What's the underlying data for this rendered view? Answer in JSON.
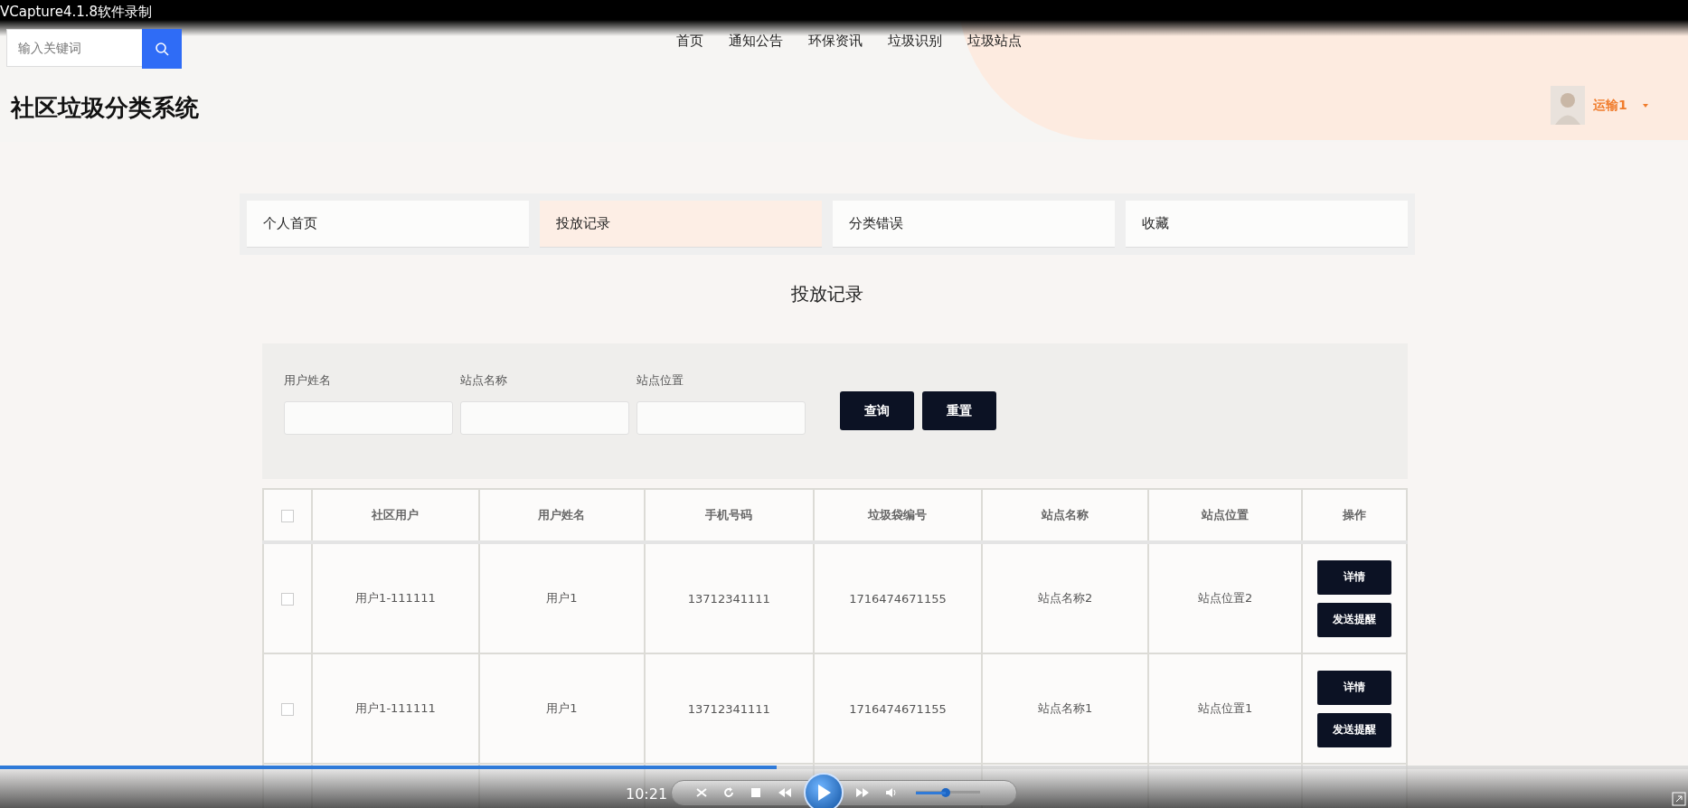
{
  "recorder": {
    "title": "VCapture4.1.8软件录制"
  },
  "header": {
    "search": {
      "placeholder": "输入关键词"
    },
    "nav": [
      "首页",
      "通知公告",
      "环保资讯",
      "垃圾识别",
      "垃圾站点"
    ],
    "site_title": "社区垃圾分类系统",
    "user": {
      "name": "运输1"
    }
  },
  "tabs": [
    {
      "label": "个人首页",
      "selected": false
    },
    {
      "label": "投放记录",
      "selected": true
    },
    {
      "label": "分类错误",
      "selected": false
    },
    {
      "label": "收藏",
      "selected": false
    }
  ],
  "heading": "投放记录",
  "filters": {
    "fields": [
      {
        "label": "用户姓名"
      },
      {
        "label": "站点名称"
      },
      {
        "label": "站点位置"
      }
    ],
    "buttons": [
      "查询",
      "重置"
    ]
  },
  "table": {
    "all_checked": false,
    "columns": [
      "社区用户",
      "用户姓名",
      "手机号码",
      "垃圾袋编号",
      "站点名称",
      "站点位置",
      "操作"
    ],
    "rows": [
      {
        "kind": "full",
        "checked": false,
        "cells": [
          "用户1-111111",
          "用户1",
          "13712341111",
          "1716474671155",
          "站点名称2",
          "站点位置2"
        ],
        "actions": [
          "详情",
          "发送提醒"
        ]
      },
      {
        "kind": "full",
        "checked": false,
        "cells": [
          "用户1-111111",
          "用户1",
          "13712341111",
          "1716474671155",
          "站点名称1",
          "站点位置1"
        ],
        "actions": [
          "详情",
          "发送提醒"
        ]
      }
    ]
  },
  "player": {
    "time": "10:21",
    "progress": {
      "level": 0.46
    },
    "volume": {
      "level": 0.5
    }
  }
}
